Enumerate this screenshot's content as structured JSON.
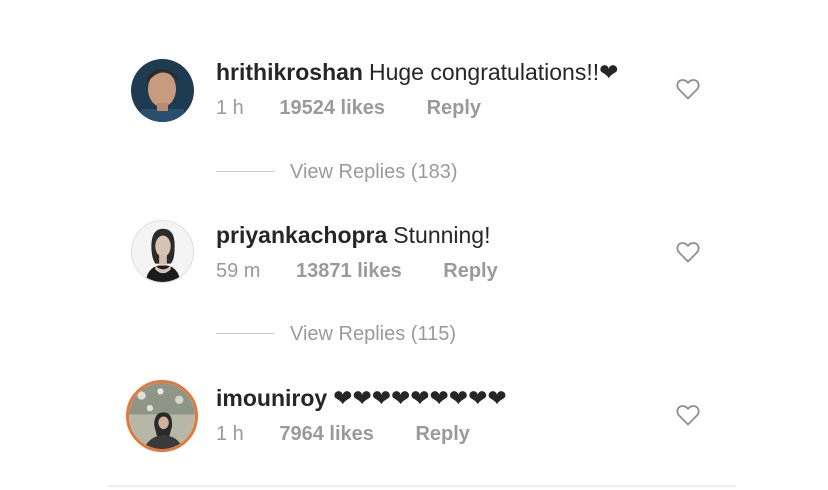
{
  "comments": [
    {
      "username": "hrithikroshan",
      "text": "Huge congratulations!!",
      "hearts": "❤",
      "time": "1 h",
      "likes": "19524 likes",
      "reply": "Reply",
      "view_replies": "View Replies (183)",
      "like_icon": "heart-outline-icon"
    },
    {
      "username": "priyankachopra",
      "text": "Stunning!",
      "hearts": "",
      "time": "59 m",
      "likes": "13871 likes",
      "reply": "Reply",
      "view_replies": "View Replies (115)",
      "like_icon": "heart-outline-icon"
    },
    {
      "username": "imouniroy",
      "text": "",
      "hearts": "❤❤❤❤❤❤❤❤❤",
      "time": "1 h",
      "likes": "7964 likes",
      "reply": "Reply",
      "like_icon": "heart-outline-icon"
    }
  ],
  "colors": {
    "text": "#262626",
    "meta": "#9a9a9a",
    "story_ring": "#e2793c"
  }
}
